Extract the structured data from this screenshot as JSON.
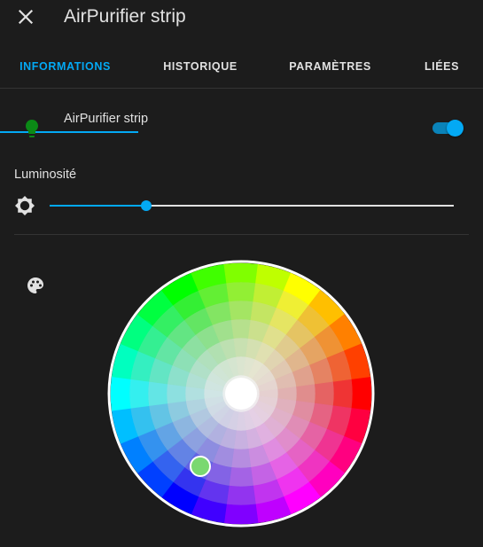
{
  "header": {
    "title": "AirPurifier strip",
    "close_icon": "close-icon"
  },
  "tabs": [
    {
      "label": "INFORMATIONS",
      "active": true
    },
    {
      "label": "HISTORIQUE",
      "active": false
    },
    {
      "label": "PARAMÈTRES",
      "active": false
    },
    {
      "label": "LIÉES",
      "active": false
    }
  ],
  "entity": {
    "name": "AirPurifier strip",
    "icon": "lightbulb-icon",
    "icon_color": "#4caf50",
    "state_on": true
  },
  "brightness": {
    "label": "Luminosité",
    "icon": "brightness-icon",
    "value_percent": 24
  },
  "color_picker": {
    "icon": "palette-icon"
  },
  "colors": {
    "accent": "#03a9f4",
    "background": "#1c1c1c",
    "text": "#e1e1e1"
  }
}
